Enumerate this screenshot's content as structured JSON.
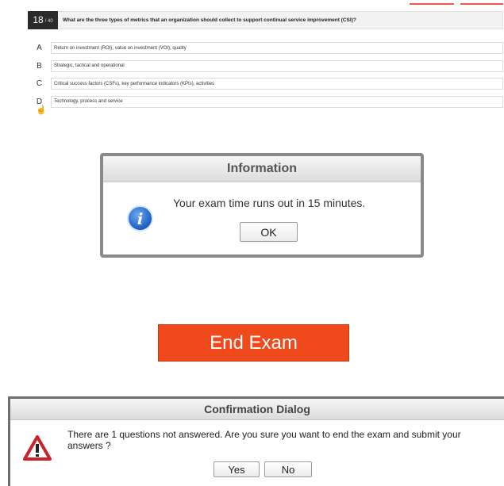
{
  "question": {
    "number": "18",
    "total": "/ 40",
    "text": "What are the three types of metrics that an organization should collect to support continual service improvement (CSI)?"
  },
  "options": [
    {
      "letter": "A",
      "text": "Return on investment (ROI), value on investment (VOI), quality"
    },
    {
      "letter": "B",
      "text": "Strategic, tactical and operational"
    },
    {
      "letter": "C",
      "text": "Critical success factors (CSFs), key performance indicators (KPIs), activities"
    },
    {
      "letter": "D",
      "text": "Technology, process and service"
    }
  ],
  "info_dialog": {
    "title": "Information",
    "message": "Your exam time runs out in 15 minutes.",
    "ok_label": "OK",
    "icon": "info-icon"
  },
  "end_exam": {
    "label": "End Exam",
    "color": "#f04a1c"
  },
  "confirm_dialog": {
    "title": "Confirmation Dialog",
    "message": "There are 1 questions not answered. Are you sure you want to end the exam and submit your answers ?",
    "yes_label": "Yes",
    "no_label": "No",
    "icon": "warning-icon"
  }
}
